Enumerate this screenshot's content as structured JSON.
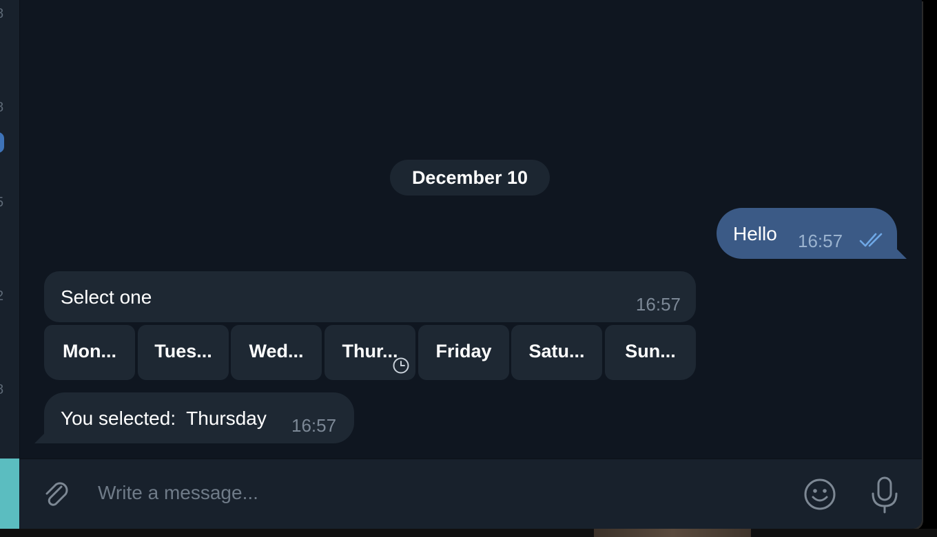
{
  "date_separator": "December 10",
  "rail_marks": [
    "8",
    "8",
    "5",
    "2",
    "8"
  ],
  "outgoing": [
    {
      "text": "Hello",
      "time": "16:57",
      "status": "read-double-check-icon"
    }
  ],
  "incoming": [
    {
      "text": "Select one",
      "time": "16:57"
    },
    {
      "text": "You selected:  Thursday",
      "time": "16:57"
    }
  ],
  "inline_keyboard": [
    {
      "label": "Mon..."
    },
    {
      "label": "Tues..."
    },
    {
      "label": "Wed..."
    },
    {
      "label": "Thur...",
      "pending": true
    },
    {
      "label": "Friday"
    },
    {
      "label": "Satu..."
    },
    {
      "label": "Sun..."
    }
  ],
  "composer": {
    "placeholder": "Write a message..."
  },
  "colors": {
    "background": "#0f1620",
    "bubble_out": "#3b5a86",
    "bubble_in": "#1e2833",
    "accent": "#5bbdc0",
    "ticks": "#6fa8e6"
  }
}
